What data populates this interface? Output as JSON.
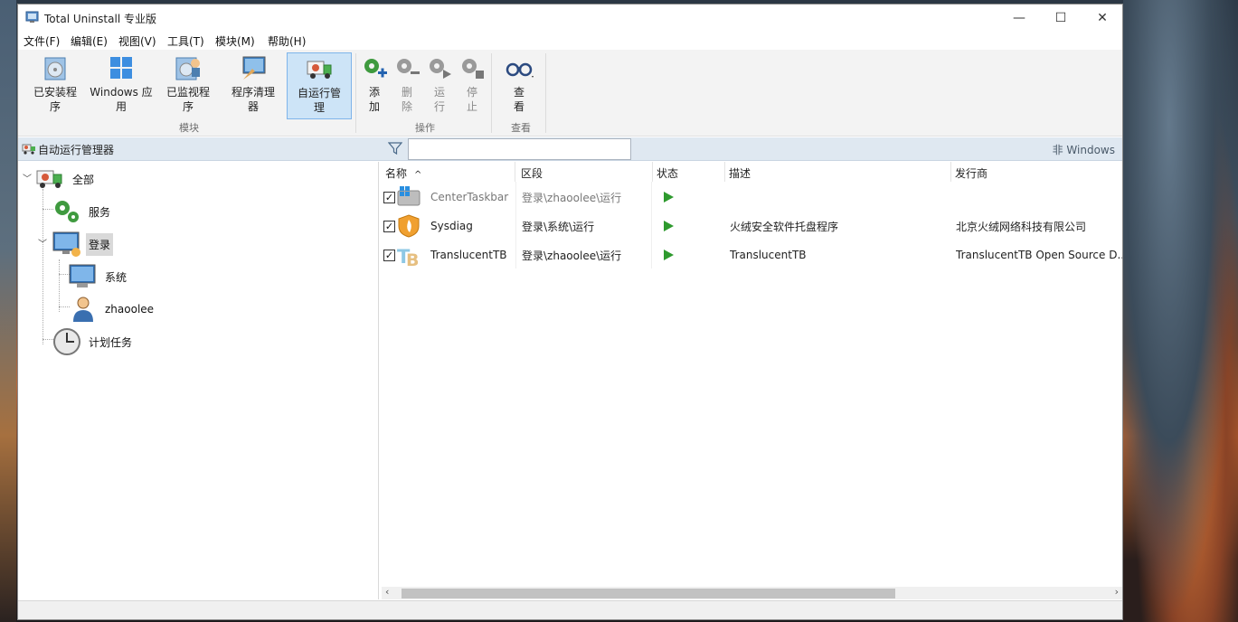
{
  "window": {
    "title": "Total Uninstall 专业版"
  },
  "menu": [
    "文件(F)",
    "编辑(E)",
    "视图(V)",
    "工具(T)",
    "模块(M)",
    "帮助(H)"
  ],
  "ribbon": {
    "modules": {
      "group_label": "模块",
      "buttons": [
        "已安装程\n序",
        "Windows 应\n用",
        "已监视程\n序",
        "程序清理\n器",
        "自运行管\n理"
      ]
    },
    "actions": {
      "group_label": "操作",
      "buttons": [
        "添\n加",
        "删\n除",
        "运\n行",
        "停\n止"
      ]
    },
    "view": {
      "group_label": "查看",
      "button": "查\n看"
    }
  },
  "header": {
    "title": "自动运行管理器",
    "filter_placeholder": "",
    "non_windows": "非 Windows"
  },
  "tree": {
    "root": "全部",
    "services": "服务",
    "login": "登录",
    "system": "系统",
    "user": "zhaoolee",
    "scheduled": "计划任务"
  },
  "list": {
    "columns": [
      "名称",
      "区段",
      "状态",
      "描述",
      "发行商"
    ],
    "rows": [
      {
        "name": "CenterTaskbar",
        "section": "登录\\zhaoolee\\运行",
        "description": "",
        "publisher": "",
        "disabled": true
      },
      {
        "name": "Sysdiag",
        "section": "登录\\系统\\运行",
        "description": "火绒安全软件托盘程序",
        "publisher": "北京火绒网络科技有限公司",
        "disabled": false
      },
      {
        "name": "TranslucentTB",
        "section": "登录\\zhaoolee\\运行",
        "description": "TranslucentTB",
        "publisher": "TranslucentTB Open Source D...",
        "disabled": false
      }
    ]
  },
  "colors": {
    "selected_bg": "#cde4f7",
    "header_bg": "#dfe8f1",
    "play": "#2e9a2e"
  }
}
